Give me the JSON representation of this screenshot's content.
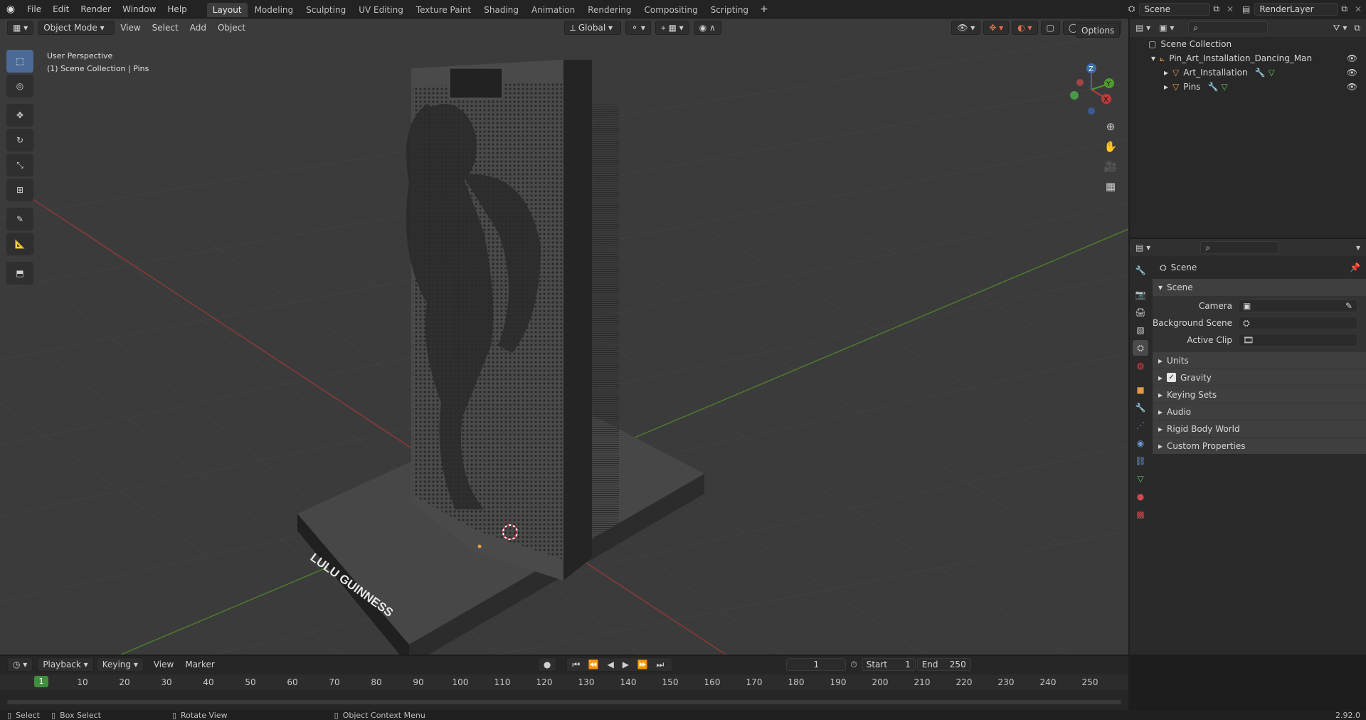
{
  "app": {
    "menu": [
      "File",
      "Edit",
      "Render",
      "Window",
      "Help"
    ],
    "workspaces": [
      "Layout",
      "Modeling",
      "Sculpting",
      "UV Editing",
      "Texture Paint",
      "Shading",
      "Animation",
      "Rendering",
      "Compositing",
      "Scripting"
    ],
    "active_workspace": "Layout",
    "scene_name": "Scene",
    "render_layer": "RenderLayer",
    "version": "2.92.0"
  },
  "viewport": {
    "mode": "Object Mode",
    "header_menu": [
      "View",
      "Select",
      "Add",
      "Object"
    ],
    "transform_orientation": "Global",
    "options_label": "Options",
    "overlay_text": {
      "line1": "User Perspective",
      "line2": "(1) Scene Collection | Pins"
    },
    "brand_text": "LULU GUINNESS",
    "axis_labels": {
      "x": "X",
      "y": "Y",
      "z": "Z"
    }
  },
  "outliner": {
    "root": "Scene Collection",
    "items": [
      {
        "label": "Pin_Art_Installation_Dancing_Man",
        "indent": 1
      },
      {
        "label": "Art_Installation",
        "indent": 2
      },
      {
        "label": "Pins",
        "indent": 2
      }
    ]
  },
  "properties": {
    "context_label": "Scene",
    "panel_title": "Scene",
    "fields": [
      {
        "label": "Camera",
        "value": ""
      },
      {
        "label": "Background Scene",
        "value": ""
      },
      {
        "label": "Active Clip",
        "value": ""
      }
    ],
    "subpanels": [
      "Units",
      "Gravity",
      "Keying Sets",
      "Audio",
      "Rigid Body World",
      "Custom Properties"
    ],
    "gravity_checked": true
  },
  "timeline": {
    "menus": [
      "Playback",
      "Keying",
      "View",
      "Marker"
    ],
    "current_frame": "1",
    "start_label": "Start",
    "start": "1",
    "end_label": "End",
    "end": "250",
    "ticks": [
      "10",
      "20",
      "30",
      "40",
      "50",
      "60",
      "70",
      "80",
      "90",
      "100",
      "110",
      "120",
      "130",
      "140",
      "150",
      "160",
      "170",
      "180",
      "190",
      "200",
      "210",
      "220",
      "230",
      "240",
      "250"
    ],
    "playhead": "1"
  },
  "statusbar": {
    "items": [
      "Select",
      "Box Select",
      "Rotate View",
      "Object Context Menu"
    ]
  },
  "colors": {
    "accent": "#4b6a95",
    "x_axis": "#8a3a3a",
    "y_axis": "#4f7a2d",
    "z_axis": "#3a6ab8",
    "playhead": "#3f8f3f"
  }
}
